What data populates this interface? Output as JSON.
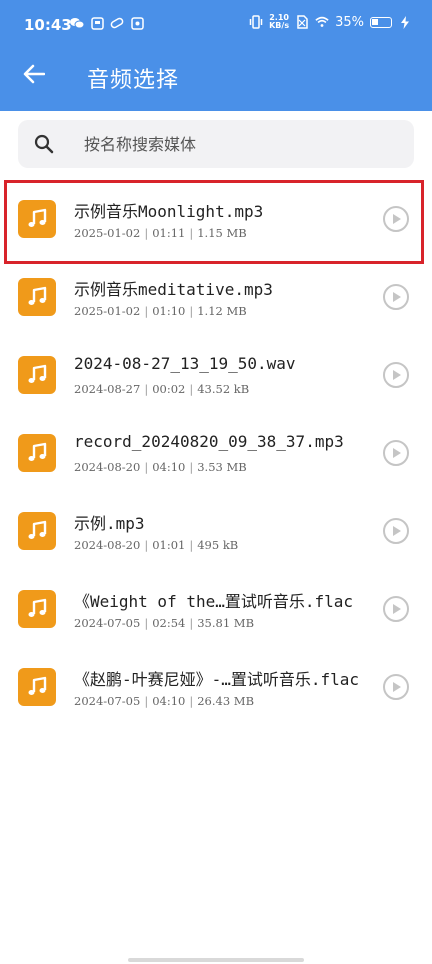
{
  "status_bar": {
    "time": "10:43",
    "net_speed_value": "2.10",
    "net_speed_unit": "KB/s",
    "battery": "35%"
  },
  "header": {
    "title": "音频选择",
    "back_icon": "arrow-left-icon"
  },
  "search": {
    "placeholder": "按名称搜索媒体",
    "icon": "search-icon"
  },
  "files": [
    {
      "name": "示例音乐Moonlight.mp3",
      "date": "2025-01-02",
      "duration": "01:11",
      "size": "1.15 MB",
      "selected": true
    },
    {
      "name": "示例音乐meditative.mp3",
      "date": "2025-01-02",
      "duration": "01:10",
      "size": "1.12 MB",
      "selected": false
    },
    {
      "name": "2024-08-27_13_19_50.wav",
      "date": "2024-08-27",
      "duration": "00:02",
      "size": "43.52 kB",
      "selected": false
    },
    {
      "name": "record_20240820_09_38_37.mp3",
      "date": "2024-08-20",
      "duration": "04:10",
      "size": "3.53 MB",
      "selected": false
    },
    {
      "name": "示例.mp3",
      "date": "2024-08-20",
      "duration": "01:01",
      "size": "495 kB",
      "selected": false
    },
    {
      "name": "《Weight of the…置试听音乐.flac",
      "date": "2024-07-05",
      "duration": "02:54",
      "size": "35.81 MB",
      "selected": false
    },
    {
      "name": "《赵鹏-叶赛尼娅》-…置试听音乐.flac",
      "date": "2024-07-05",
      "duration": "04:10",
      "size": "26.43 MB",
      "selected": false
    }
  ],
  "colors": {
    "header_bg": "#4a90e8",
    "file_icon_bg": "#f09a1a",
    "selection_border": "#d8232a"
  }
}
